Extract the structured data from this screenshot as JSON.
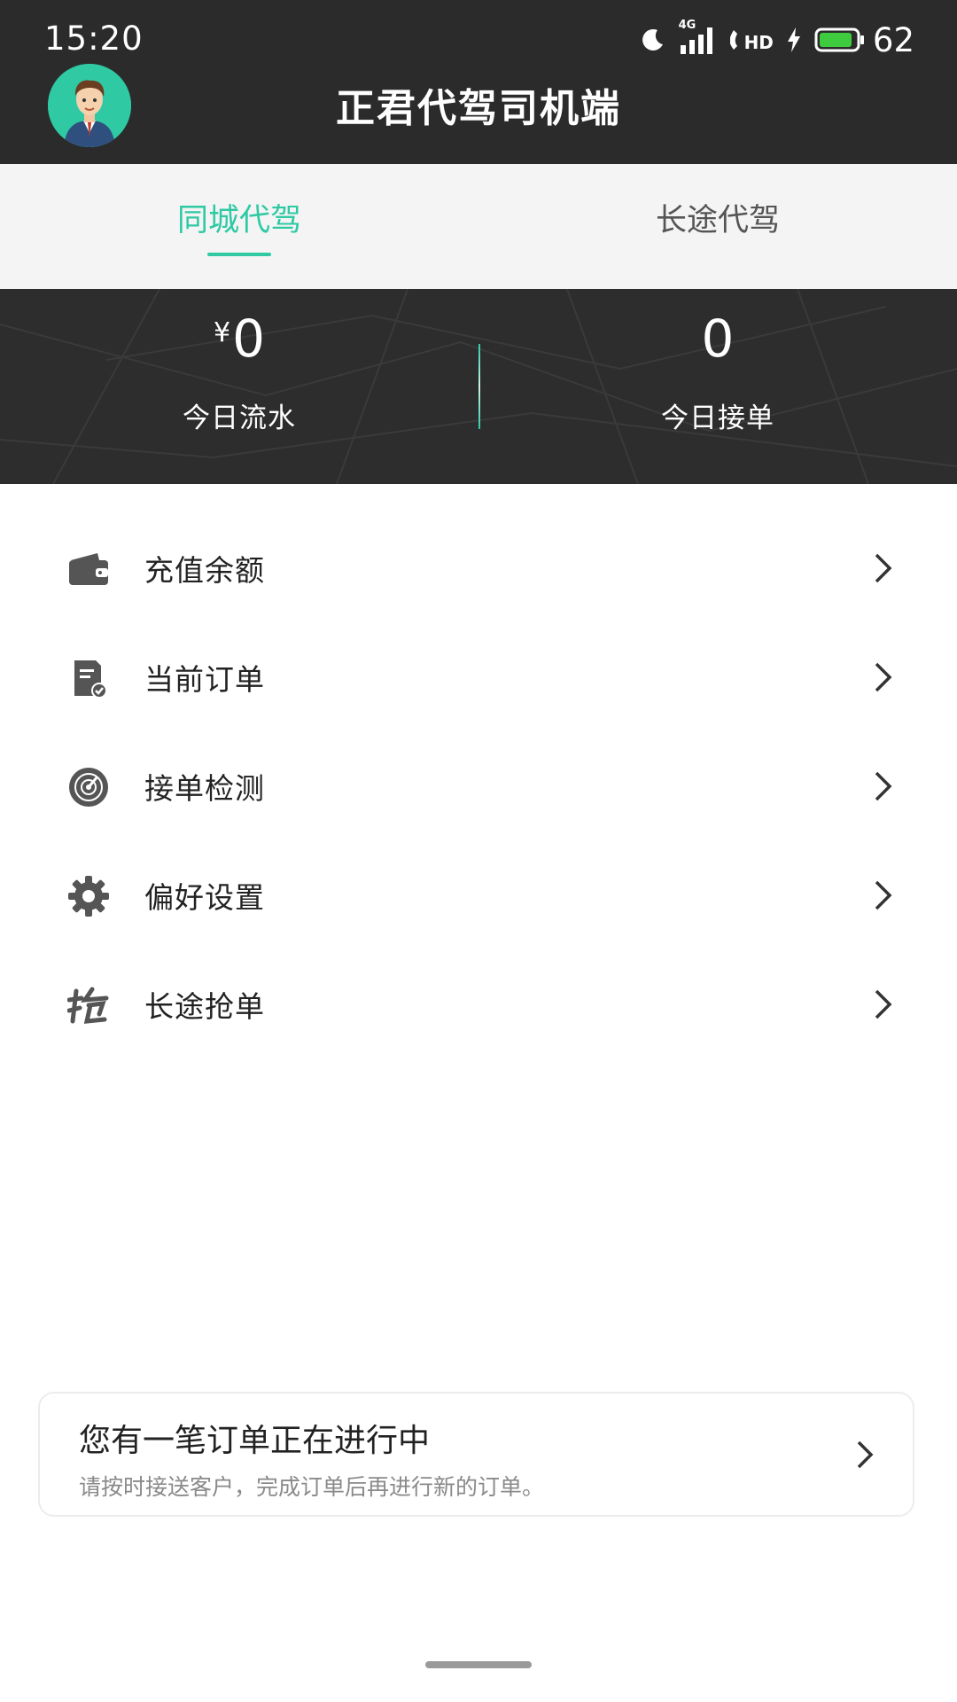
{
  "status_bar": {
    "time": "15:20",
    "network": "4G",
    "hd": "HD",
    "battery": "62"
  },
  "header": {
    "title": "正君代驾司机端",
    "avatar_icon": "driver-avatar-icon"
  },
  "tabs": [
    {
      "label": "同城代驾",
      "active": true
    },
    {
      "label": "长途代驾",
      "active": false
    }
  ],
  "stats": {
    "revenue_currency": "¥",
    "revenue_value": "0",
    "revenue_label": "今日流水",
    "orders_value": "0",
    "orders_label": "今日接单"
  },
  "menu": [
    {
      "label": "充值余额",
      "icon": "wallet-icon"
    },
    {
      "label": "当前订单",
      "icon": "order-check-icon"
    },
    {
      "label": "接单检测",
      "icon": "radar-icon"
    },
    {
      "label": "偏好设置",
      "icon": "gear-icon"
    },
    {
      "label": "长途抢单",
      "icon": "grab-order-icon"
    }
  ],
  "notice": {
    "title": "您有一笔订单正在进行中",
    "description": "请按时接送客户，完成订单后再进行新的订单。"
  },
  "colors": {
    "accent": "#2fc9a4",
    "header_bg": "#2b2b2b",
    "tabs_bg": "#f4f4f4",
    "stats_bg": "#2d2d2d"
  }
}
